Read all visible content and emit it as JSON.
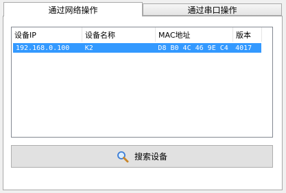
{
  "tabs": {
    "network": "通过网络操作",
    "serial": "通过串口操作"
  },
  "table": {
    "columns": [
      "设备IP",
      "设备名称",
      "MAC地址",
      "版本"
    ],
    "rows": [
      [
        "192.168.0.100",
        "K2",
        "D8 B0 4C 46 9E C4",
        "4017"
      ]
    ]
  },
  "search": {
    "label": "搜索设备",
    "icon": "magnifier-icon"
  }
}
